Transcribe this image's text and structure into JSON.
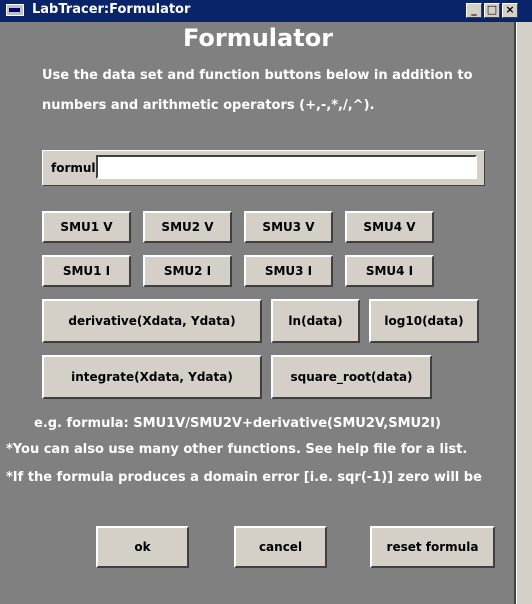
{
  "window": {
    "title": "LabTracer:Formulator",
    "minimize_label": "_",
    "maximize_label": "□",
    "close_label": "×"
  },
  "main": {
    "heading": "Formulator",
    "instructions_line1": "Use the data set and function buttons below in addition to",
    "instructions_line2": "numbers and arithmetic operators (+,-,*,/,^).",
    "formula_label": "formula:",
    "formula_value": "",
    "data_buttons": {
      "smu1v": "SMU1 V",
      "smu2v": "SMU2 V",
      "smu3v": "SMU3 V",
      "smu4v": "SMU4 V",
      "smu1i": "SMU1 I",
      "smu2i": "SMU2 I",
      "smu3i": "SMU3 I",
      "smu4i": "SMU4 I"
    },
    "function_buttons": {
      "derivative": "derivative(Xdata, Ydata)",
      "ln": "ln(data)",
      "log10": "log10(data)",
      "integrate": "integrate(Xdata, Ydata)",
      "square_root": "square_root(data)"
    },
    "example": "e.g. formula: SMU1V/SMU2V+derivative(SMU2V,SMU2I)",
    "note1": "*You can also use many other functions. See help file for a list.",
    "note2": "*If the formula produces a domain error [i.e. sqr(-1)] zero will be"
  },
  "footer": {
    "ok_label": "ok",
    "cancel_label": "cancel",
    "reset_label": "reset formula"
  },
  "colors": {
    "title_bar": "#0a246a",
    "client_bg": "#808080",
    "button_face": "#d4d0c8"
  }
}
